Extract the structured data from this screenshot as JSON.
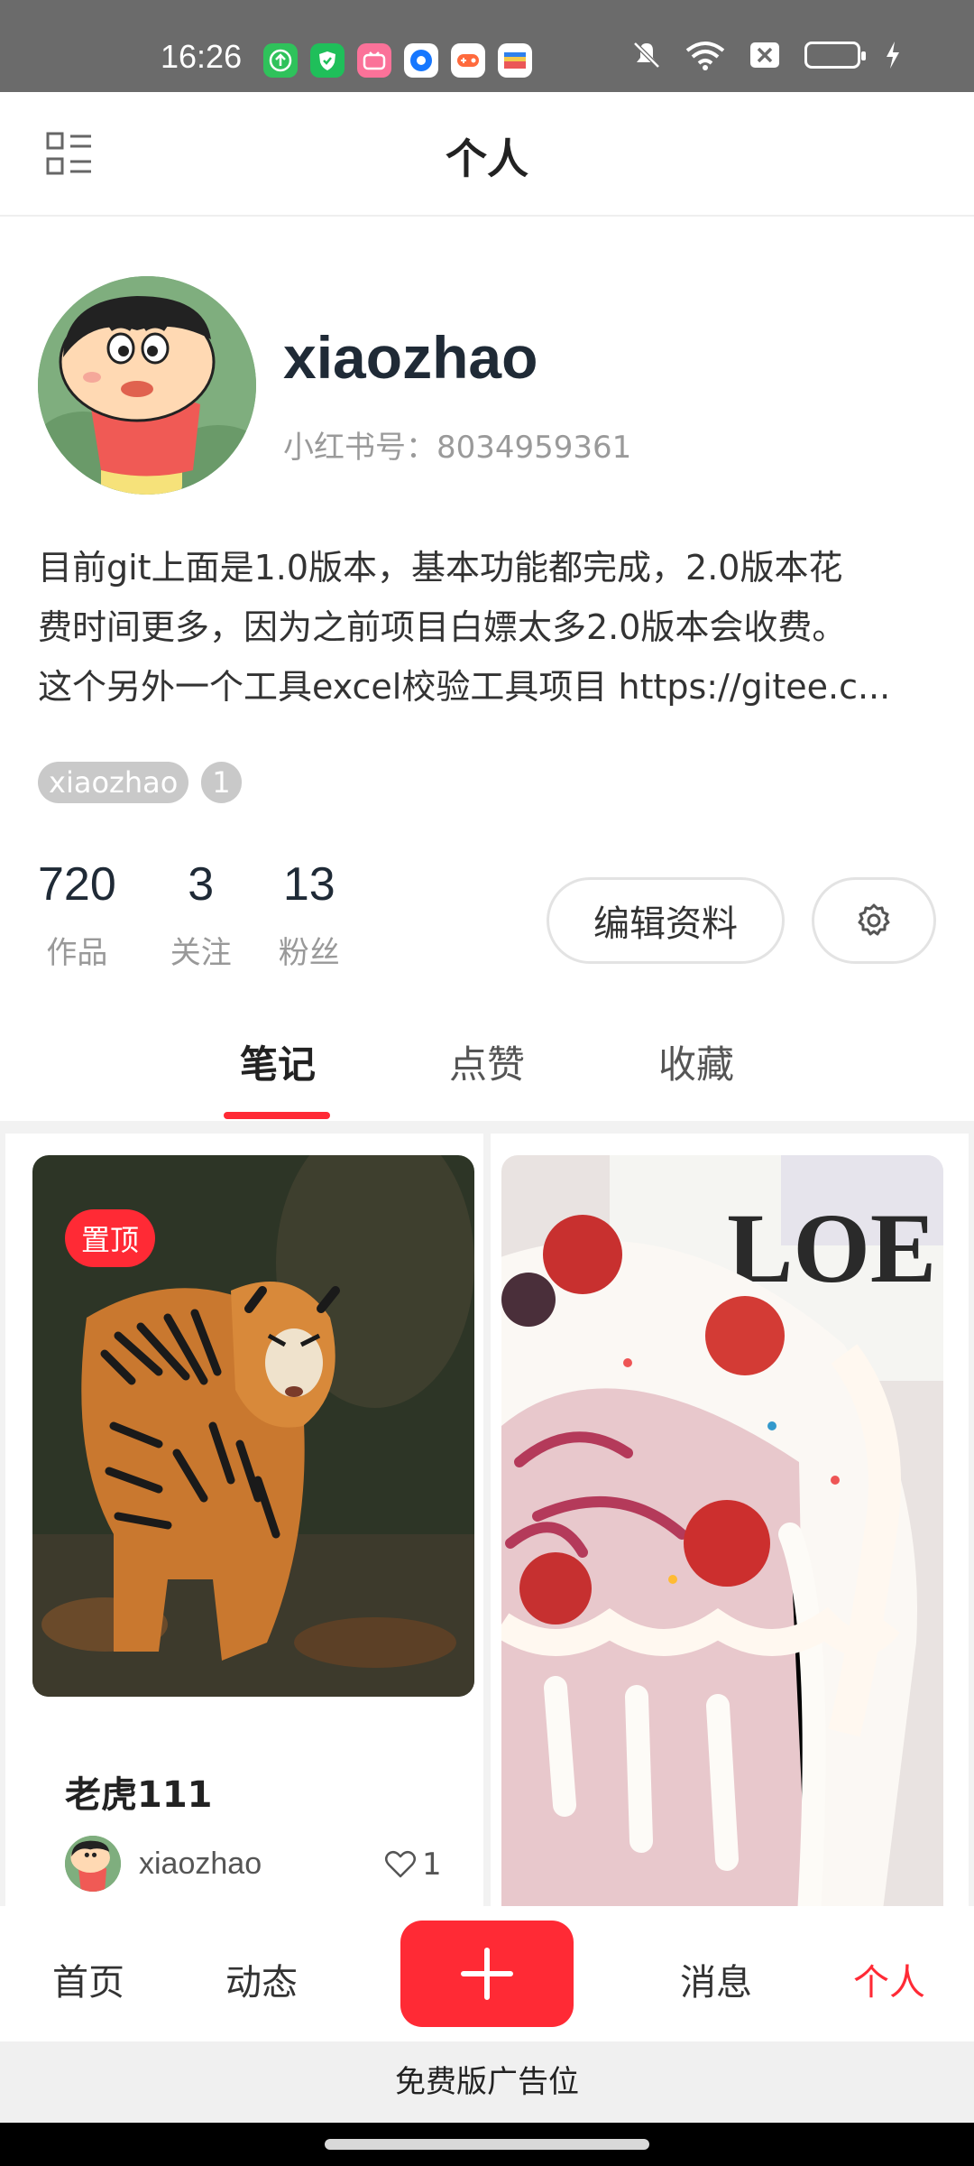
{
  "status_bar": {
    "time": "16:26",
    "app_icons": [
      {
        "name": "upload-app-icon",
        "color": "#2fc25b"
      },
      {
        "name": "shield-app-icon",
        "color": "#1fbf5a"
      },
      {
        "name": "bilibili-app-icon",
        "color": "#fb7299"
      },
      {
        "name": "circle-app-icon",
        "color": "#1677ff"
      },
      {
        "name": "game-app-icon",
        "color": "#ffffff"
      },
      {
        "name": "wallet-app-icon",
        "color": "#ffffff"
      }
    ]
  },
  "header": {
    "title": "个人"
  },
  "profile": {
    "username": "xiaozhao",
    "id_label": "小红书号：8034959361",
    "bio_lines": [
      "目前git上面是1.0版本，基本功能都完成，2.0版本花",
      "费时间更多，因为之前项目白嫖太多2.0版本会收费。",
      "这个另外一个工具excel校验工具项目 https://gitee.c..."
    ],
    "tags": [
      "xiaozhao",
      "1"
    ],
    "stats": [
      {
        "value": "720",
        "label": "作品"
      },
      {
        "value": "3",
        "label": "关注"
      },
      {
        "value": "13",
        "label": "粉丝"
      }
    ],
    "edit_label": "编辑资料"
  },
  "tabs": [
    {
      "label": "笔记",
      "active": true
    },
    {
      "label": "点赞",
      "active": false
    },
    {
      "label": "收藏",
      "active": false
    }
  ],
  "feed": {
    "cards": [
      {
        "badge": "置顶",
        "title": "老虎111",
        "author": "xiaozhao",
        "likes": "1"
      }
    ]
  },
  "bottom_nav": {
    "items": [
      {
        "label": "首页",
        "active": false
      },
      {
        "label": "动态",
        "active": false
      },
      {
        "label": "消息",
        "active": false
      },
      {
        "label": "个人",
        "active": true
      }
    ],
    "accent": "#ff2a35"
  },
  "ad": {
    "text": "免费版广告位"
  }
}
